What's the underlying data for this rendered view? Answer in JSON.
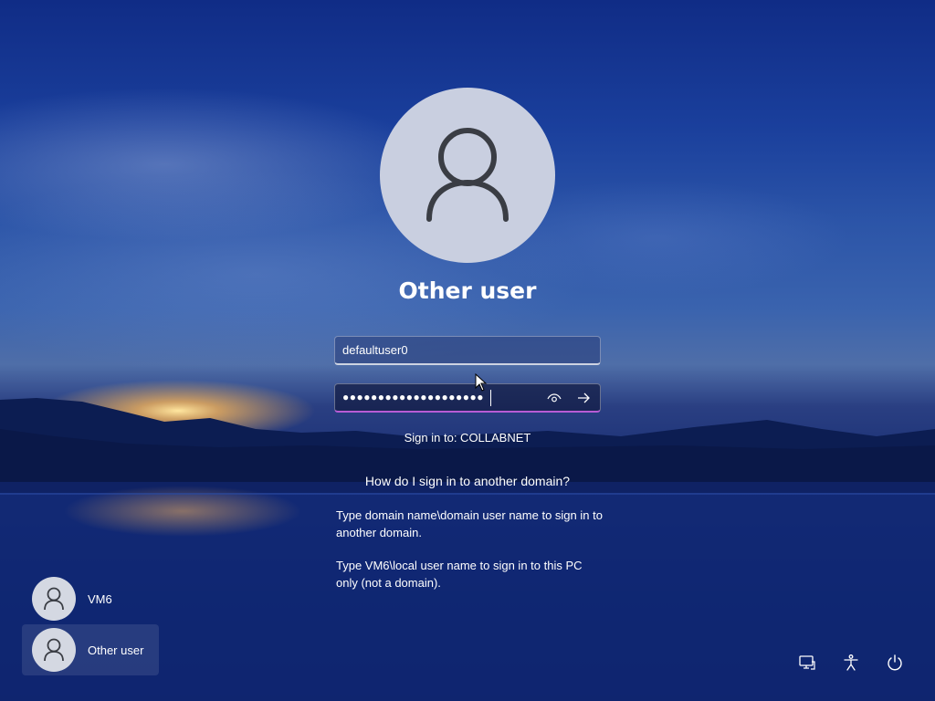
{
  "user": {
    "title": "Other user"
  },
  "form": {
    "username_value": "defaultuser0",
    "password_masked": "●●●●●●●●●●●●●●●●●●●●",
    "sign_in_to": "Sign in to: COLLABNET"
  },
  "help": {
    "link": "How do I sign in to another domain?",
    "paragraph1": "Type domain name\\domain user name to sign in to another domain.",
    "paragraph2": "Type VM6\\local user name to sign in to this PC only (not a domain)."
  },
  "user_list": [
    {
      "name": "VM6"
    },
    {
      "name": "Other user"
    }
  ],
  "icons": {
    "avatar": "person-icon",
    "reveal": "eye-icon",
    "submit": "arrow-right-icon",
    "network": "network-icon",
    "accessibility": "accessibility-icon",
    "power": "power-icon"
  },
  "colors": {
    "password_focus_underline": "#b85cd6",
    "avatar_bg": "#c9cfe0"
  }
}
